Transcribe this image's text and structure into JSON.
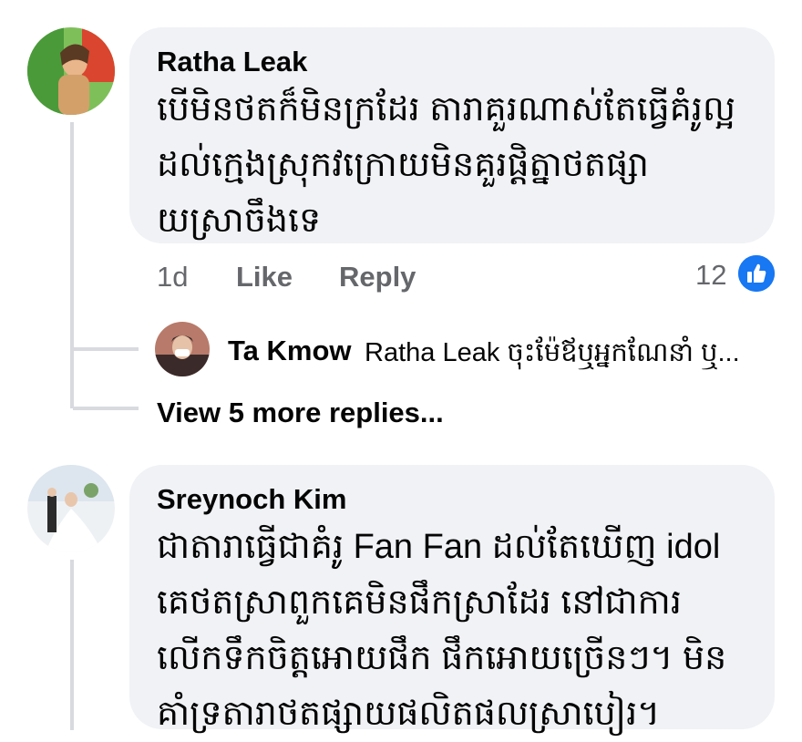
{
  "comments": [
    {
      "author": "Ratha Leak",
      "lines": [
        "បើមិនថតក៏មិនក្រដែរ តារាគួរណាស់តែធ្វើគំរូល្អ",
        "ដល់ក្មេងស្រុកវក្រោយមិនគួរផ្ដិត្នាថតផ្សា",
        "យស្រាចឹងទេ"
      ],
      "time": "1d",
      "like_label": "Like",
      "reply_label": "Reply",
      "reaction_count": "12",
      "reaction_icon": "thumbs-up-icon",
      "replies": [
        {
          "author": "Ta Kmow",
          "text": "Ratha Leak ចុះម៉ែឪឬអ្នកណែនាំ ឬ..."
        }
      ],
      "view_more": "View 5 more replies..."
    },
    {
      "author": "Sreynoch Kim",
      "lines": [
        "ជាតារាធ្វើជាគំរូ Fan Fan ដល់តែឃើញ idol",
        "គេថតស្រាពួកគេមិនផឹកស្រាដែរ នៅជាការ",
        "លើកទឹកចិត្តអោយផឹក ផឹកអោយច្រើនៗ។ មិន",
        "គាំទ្រតារាថតផ្សាយផលិតផលស្រាបៀរ។"
      ]
    }
  ],
  "colors": {
    "bubble": "#f0f2f5",
    "meta_text": "#65676b",
    "like_blue": "#1877f2",
    "thread_line": "#d8dadf"
  }
}
